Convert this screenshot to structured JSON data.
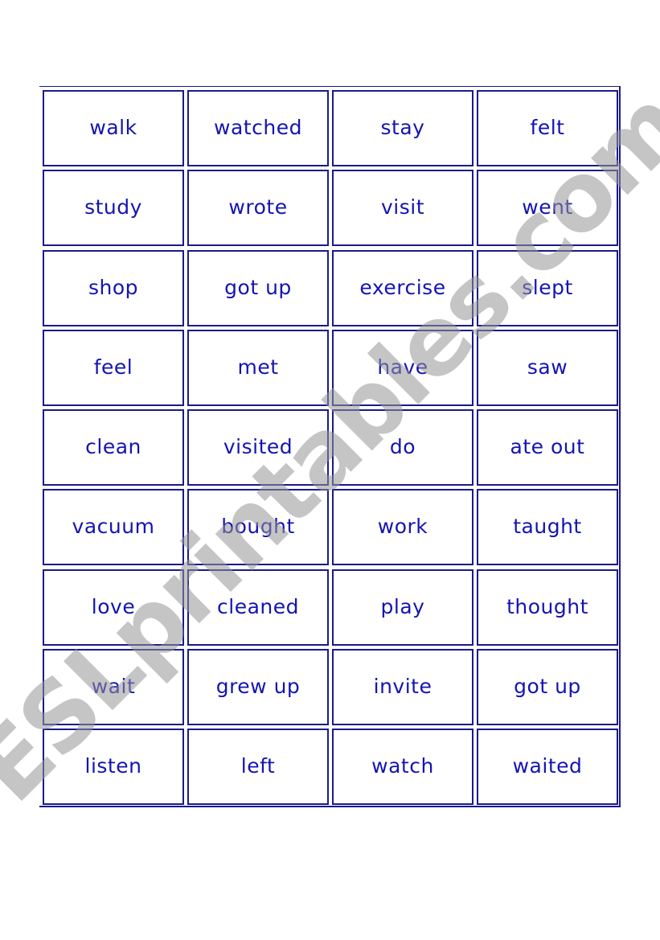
{
  "colors": {
    "border": "#1a1a8a",
    "text": "#1414b4",
    "watermark": "#969696"
  },
  "watermark": "ESLprintables.com",
  "cards": [
    [
      "walk",
      "watched",
      "stay",
      "felt"
    ],
    [
      "study",
      "wrote",
      "visit",
      "went"
    ],
    [
      "shop",
      "got up",
      "exercise",
      "slept"
    ],
    [
      "feel",
      "met",
      "have",
      "saw"
    ],
    [
      "clean",
      "visited",
      "do",
      "ate out"
    ],
    [
      "vacuum",
      "bought",
      "work",
      "taught"
    ],
    [
      "love",
      "cleaned",
      "play",
      "thought"
    ],
    [
      "wait",
      "grew up",
      "invite",
      "got up"
    ],
    [
      "listen",
      "left",
      "watch",
      "waited"
    ]
  ]
}
